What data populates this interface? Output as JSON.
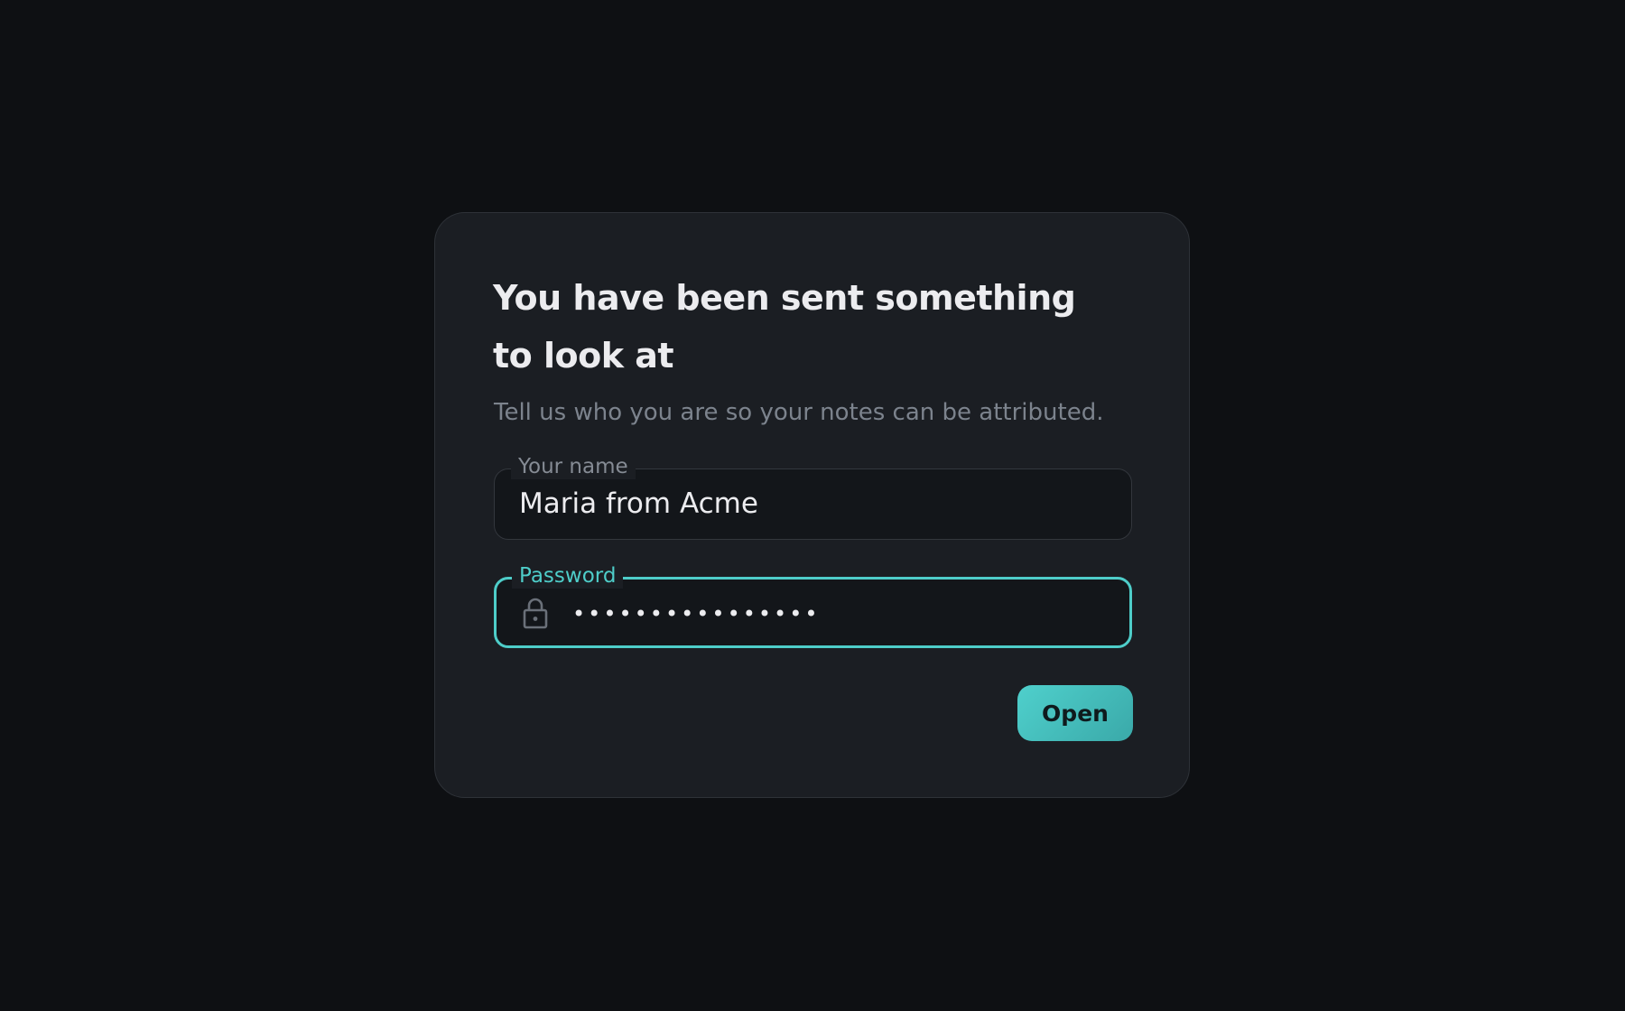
{
  "dialog": {
    "title": "You have been sent something to look at",
    "subtitle": "Tell us who you are so your notes can be attributed."
  },
  "name_field": {
    "label": "Your name",
    "value": "Maria from Acme"
  },
  "password_field": {
    "label": "Password",
    "masked_value": "••••••••••••••••",
    "icon": "lock-icon"
  },
  "actions": {
    "open_label": "Open"
  },
  "colors": {
    "background": "#0e1013",
    "card": "#1b1e23",
    "accent": "#4ecdc9",
    "text": "#ececef",
    "muted": "#7c838d"
  }
}
